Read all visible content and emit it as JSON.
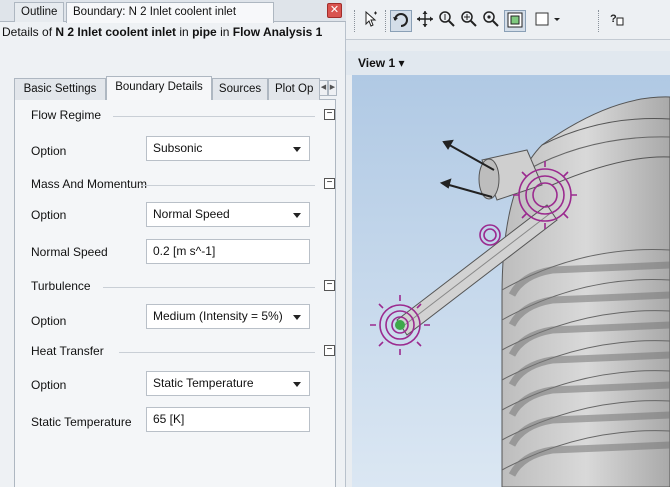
{
  "tabs": {
    "outline": "Outline",
    "boundary": "Boundary: N 2 Inlet coolent inlet",
    "close_glyph": "✕"
  },
  "details": {
    "prefix": "Details of ",
    "object": "N 2 Inlet coolent inlet",
    "mid1": " in ",
    "domain": "pipe",
    "mid2": " in ",
    "analysis": "Flow Analysis 1"
  },
  "sub_tabs": [
    "Basic Settings",
    "Boundary Details",
    "Sources",
    "Plot Op"
  ],
  "sub_tab_active": "Boundary Details",
  "scroll_arrows": {
    "left": "◀",
    "right": "▶"
  },
  "sections": {
    "flow_regime": {
      "title": "Flow Regime",
      "option_label": "Option",
      "option_value": "Subsonic"
    },
    "mass_momentum": {
      "title": "Mass And Momentum",
      "option_label": "Option",
      "option_value": "Normal Speed",
      "speed_label": "Normal Speed",
      "speed_value": "0.2 [m s^-1]"
    },
    "turbulence": {
      "title": "Turbulence",
      "option_label": "Option",
      "option_value": "Medium (Intensity = 5%)"
    },
    "heat_transfer": {
      "title": "Heat Transfer",
      "option_label": "Option",
      "option_value": "Static Temperature",
      "temp_label": "Static Temperature",
      "temp_value": "65 [K]"
    }
  },
  "collapse_glyph": "−",
  "toolbar": {
    "icons": [
      "select-icon",
      "rotate-icon",
      "pan-icon",
      "zoom-icon",
      "zoom-box-icon",
      "zoom-fit-icon",
      "highlight-icon",
      "viewport-layout-icon",
      "help-icon"
    ]
  },
  "viewport": {
    "title": "View 1",
    "caret": "▾"
  },
  "colors": {
    "viewport_bg": "#bcd2ea",
    "geometry": "#c9c9c9",
    "boundary_marker": "#9b2a8f",
    "inlet_marker": "#3fa84a"
  }
}
